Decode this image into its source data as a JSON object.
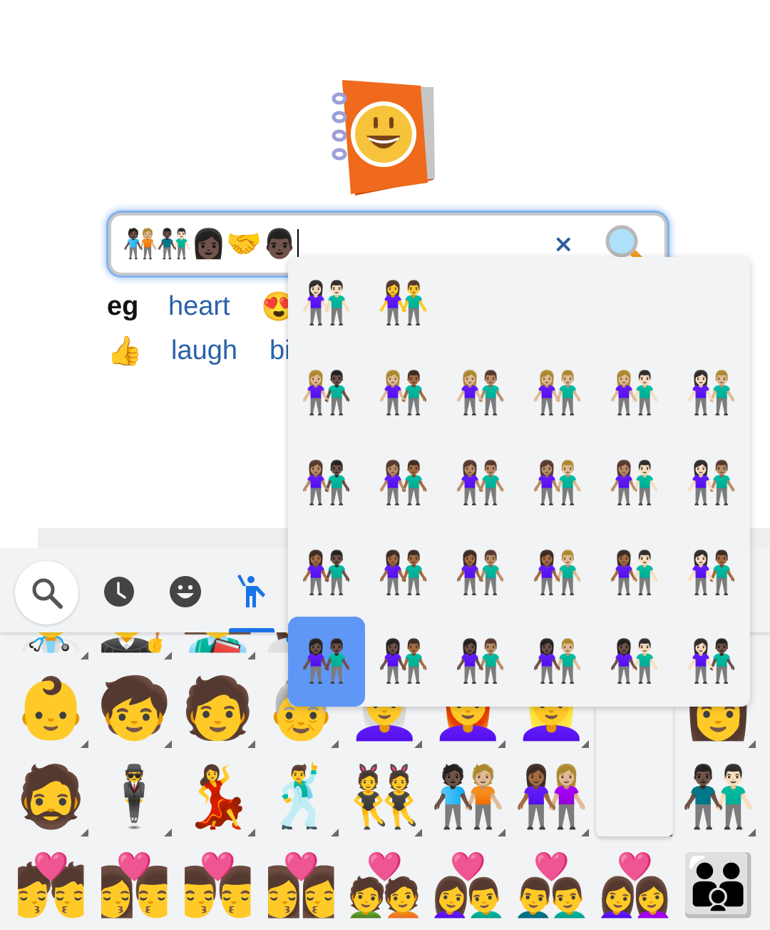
{
  "page": {
    "logo_name": "emojipedia-logo",
    "search": {
      "value": "🧑🏿‍🤝‍🧑🏼👨🏿‍🤝‍👨🏻👩🏿‍🤝‍👨🏿",
      "clear_label": "×",
      "search_button_icon": "🔍"
    },
    "examples": {
      "label": "eg",
      "items": [
        {
          "text": "heart",
          "type": "link"
        },
        {
          "text": "😍",
          "type": "emoji"
        },
        {
          "text": "👍",
          "type": "emoji"
        },
        {
          "text": "laugh",
          "type": "link"
        },
        {
          "text": "bi",
          "type": "link"
        }
      ]
    }
  },
  "keyboard": {
    "toolbar": {
      "search_icon": "search",
      "categories": [
        {
          "name": "recent",
          "icon": "clock",
          "active": false
        },
        {
          "name": "smileys",
          "icon": "smiley",
          "active": false
        },
        {
          "name": "people",
          "icon": "person-waving",
          "active": true
        }
      ],
      "accent": "#1a73e8"
    },
    "partial_row": [
      "👨‍⚕️",
      "👨‍⚖️",
      "👨‍🏫",
      "👩‍🎨"
    ],
    "rows": [
      [
        "👶",
        "🧒",
        "🧑",
        "👵",
        "👩‍🦳",
        "👩‍🦰",
        "👱‍♀️",
        "",
        "👩"
      ],
      [
        "🧔",
        "🕴️",
        "💃",
        "🕺",
        "👯",
        "🧑🏿‍🤝‍🧑🏼",
        "👩🏾‍🤝‍👩🏼",
        "",
        "👨🏿‍🤝‍👨🏻"
      ],
      [
        "💏",
        "👩‍❤️‍💋‍👨",
        "👨‍❤️‍💋‍👨",
        "👩‍❤️‍💋‍👩",
        "💑",
        "👩‍❤️‍👨",
        "👨‍❤️‍👨",
        "👩‍❤️‍👩",
        "👪"
      ]
    ],
    "variant_popup": {
      "selected_index": [
        4,
        0
      ],
      "selected_color": "#5f97f6",
      "rows": [
        [
          "👫🏻",
          "👫"
        ],
        [
          "👩🏼‍🤝‍👨🏿",
          "👩🏼‍🤝‍👨🏾",
          "👩🏼‍🤝‍👨🏽",
          "👫🏼",
          "👩🏼‍🤝‍👨🏻",
          "👩🏻‍🤝‍👨🏼"
        ],
        [
          "👩🏽‍🤝‍👨🏿",
          "👩🏽‍🤝‍👨🏾",
          "👫🏽",
          "👩🏽‍🤝‍👨🏼",
          "👩🏽‍🤝‍👨🏻",
          "👩🏻‍🤝‍👨🏽"
        ],
        [
          "👩🏾‍🤝‍👨🏿",
          "👫🏾",
          "👩🏾‍🤝‍👨🏽",
          "👩🏾‍🤝‍👨🏼",
          "👩🏾‍🤝‍👨🏻",
          "👩🏻‍🤝‍👨🏾"
        ],
        [
          "👫🏿",
          "👩🏿‍🤝‍👨🏾",
          "👩🏿‍🤝‍👨🏽",
          "👩🏿‍🤝‍👨🏼",
          "👩🏿‍🤝‍👨🏻",
          "👩🏻‍🤝‍👨🏿"
        ]
      ]
    }
  }
}
